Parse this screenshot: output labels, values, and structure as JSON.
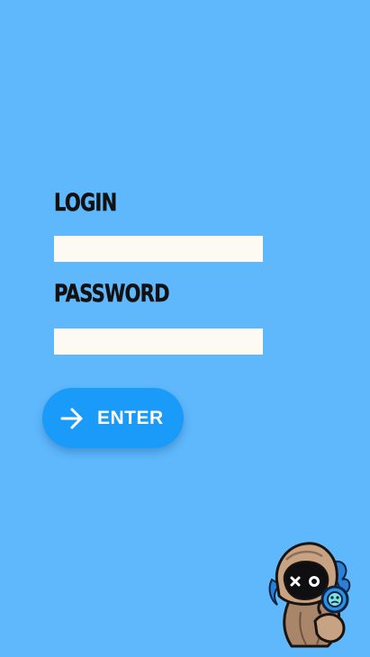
{
  "form": {
    "login_label": "LOGIN",
    "login_value": "",
    "password_label": "PASSWORD",
    "password_value": "",
    "enter_label": "ENTER",
    "enter_icon": "arrow-right-icon"
  },
  "mascot": {
    "icon": "hooded-mascot-icon"
  },
  "colors": {
    "background": "#5fb8fb",
    "button": "#1a9bf9",
    "input": "#fdfaf4",
    "label": "#111111"
  }
}
